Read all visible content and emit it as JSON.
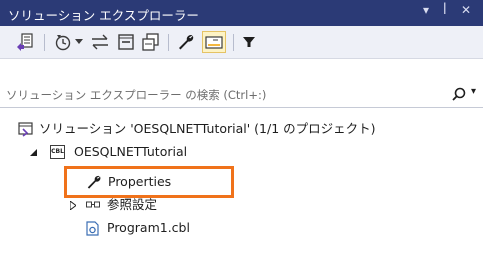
{
  "window": {
    "title": "ソリューション エクスプローラー",
    "menu_glyph": "▾",
    "pin_glyph": "ꟾ",
    "close_glyph": "✕"
  },
  "search": {
    "placeholder": "ソリューション エクスプローラー の検索 (Ctrl+:)",
    "value": ""
  },
  "tree": {
    "solution": "ソリューション 'OESQLNETTutorial' (1/1 のプロジェクト)",
    "project": "OESQLNETTutorial",
    "project_badge": "CBL",
    "properties": "Properties",
    "references": "参照設定",
    "file": "Program1.cbl"
  },
  "colors": {
    "titlebar": "#2b3a76",
    "highlight": "#f0721a",
    "toolbar": "#eef0f7"
  }
}
